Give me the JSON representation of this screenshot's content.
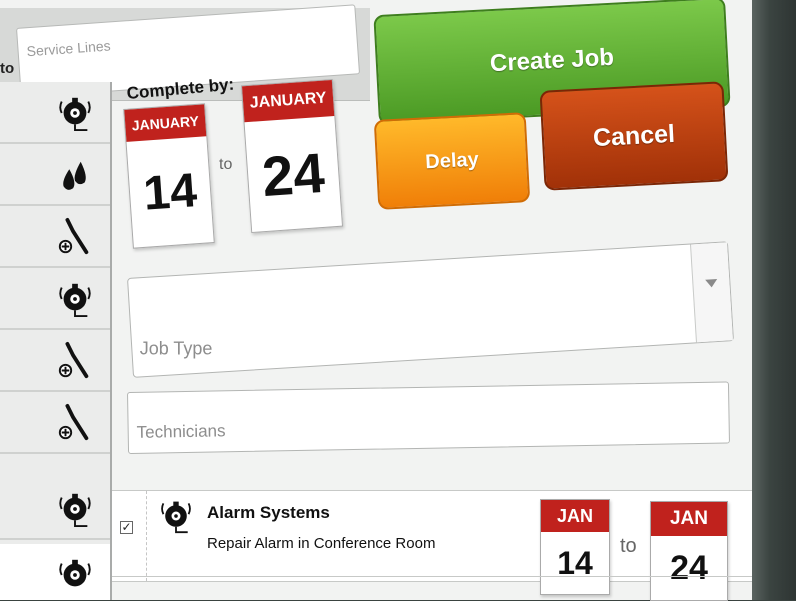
{
  "search": {
    "prefix": "to",
    "placeholder": "Service Lines"
  },
  "sidebar": {
    "items": [
      {
        "icon": "alarm-bell-icon"
      },
      {
        "icon": "water-drops-icon"
      },
      {
        "icon": "screwdriver-add-icon"
      },
      {
        "icon": "alarm-bell-icon"
      },
      {
        "icon": "screwdriver-add-icon"
      },
      {
        "icon": "screwdriver-add-icon"
      },
      {
        "icon": "alarm-bell-icon"
      },
      {
        "icon": "alarm-bell-icon"
      }
    ]
  },
  "complete_by": {
    "label": "Complete by:",
    "start": {
      "month": "JANUARY",
      "day": "14"
    },
    "separator": "to",
    "end": {
      "month": "JANUARY",
      "day": "24"
    }
  },
  "buttons": {
    "create": "Create Job",
    "delay": "Delay",
    "cancel": "Cancel"
  },
  "form": {
    "job_type_placeholder": "Job Type",
    "technicians_placeholder": "Technicians"
  },
  "job": {
    "checked": true,
    "category": "Alarm Systems",
    "description": "Repair Alarm in Conference Room",
    "start": {
      "month": "JAN",
      "day": "14"
    },
    "separator": "to",
    "end": {
      "month": "JAN",
      "day": "24"
    }
  },
  "colors": {
    "create": "#5aab31",
    "delay": "#f59a12",
    "cancel": "#b43c0e",
    "calendar_header": "#c0221d"
  }
}
